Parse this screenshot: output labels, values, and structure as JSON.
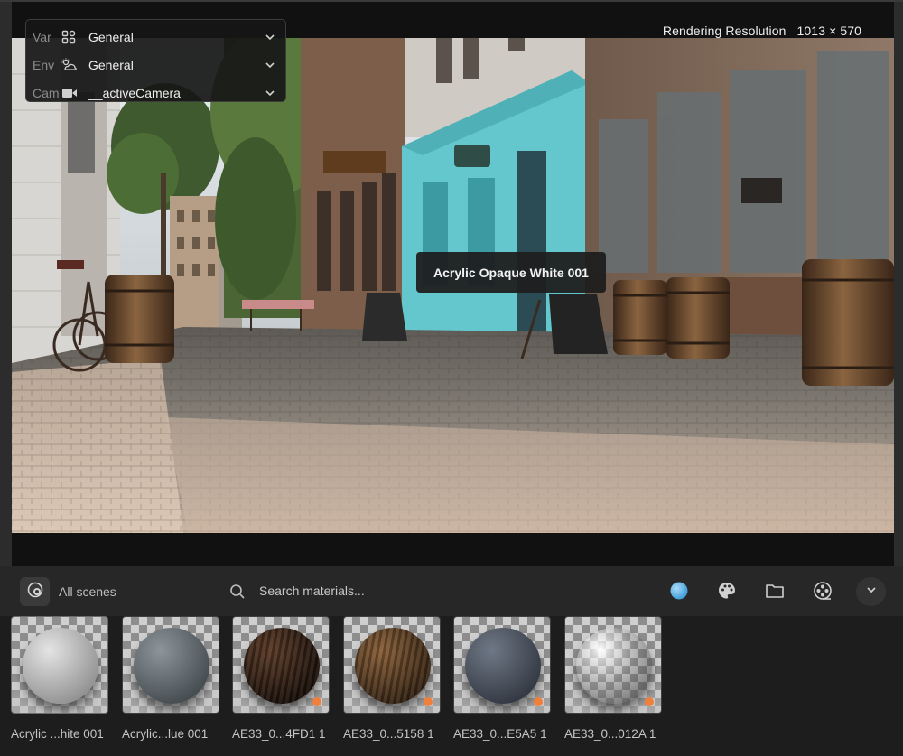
{
  "viewport": {
    "resolution_label": "Rendering Resolution",
    "resolution_value": "1013 × 570",
    "scene_selector": {
      "rows": [
        {
          "label": "Var",
          "value": "General",
          "icon": "variants-icon"
        },
        {
          "label": "Env",
          "value": "General",
          "icon": "environment-icon"
        },
        {
          "label": "Cam",
          "value": "__activeCamera",
          "icon": "camera-icon"
        }
      ]
    },
    "tooltip": "Acrylic Opaque White 001"
  },
  "material_browser": {
    "scenes_label": "All scenes",
    "search_placeholder": "Search materials...",
    "toolbar_icons": [
      "material-sphere-icon",
      "palette-icon",
      "folder-icon",
      "film-reel-icon",
      "chevron-down-icon"
    ],
    "materials": [
      {
        "label": "Acrylic ...hite 001",
        "color_light": "#e4e4e4",
        "color_dark": "#8a8a8a",
        "badge": false
      },
      {
        "label": "Acrylic...lue 001",
        "color_light": "#8c959a",
        "color_dark": "#3e4549",
        "badge": false
      },
      {
        "label": "AE33_0...4FD1 1",
        "color_light": "#5b3a26",
        "color_dark": "#120b07",
        "badge": true
      },
      {
        "label": "AE33_0...5158 1",
        "color_light": "#8a6038",
        "color_dark": "#2c1d10",
        "badge": true
      },
      {
        "label": "AE33_0...E5A5 1",
        "color_light": "#6f7886",
        "color_dark": "#2d333c",
        "badge": true
      },
      {
        "label": "AE33_0...012A 1",
        "color_light": "#d8d8d8",
        "color_dark": "#2a2a2a",
        "badge": true
      }
    ],
    "accent_color": "#f07f3c",
    "active_icon_color": "#5ab4e8"
  }
}
